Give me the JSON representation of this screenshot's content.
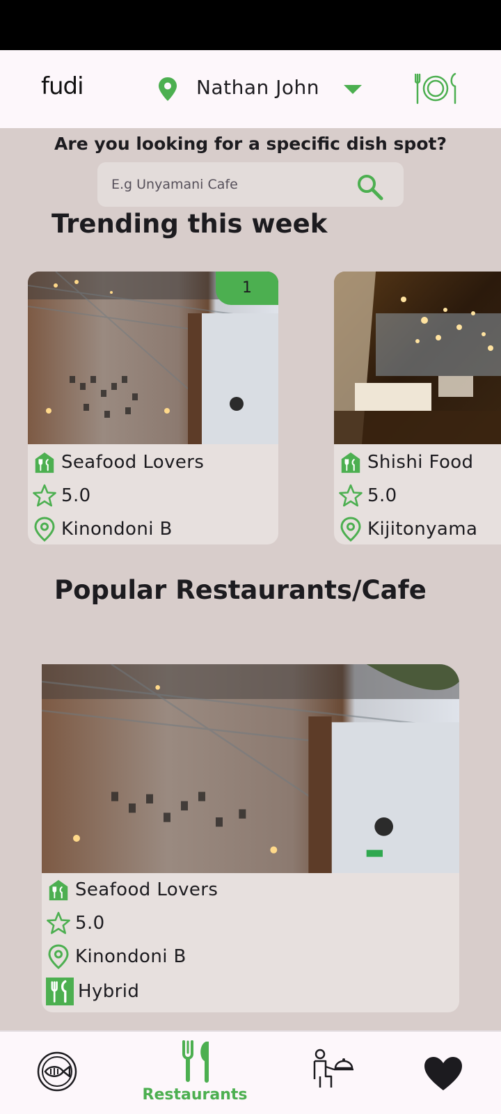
{
  "header": {
    "logo": "fudi",
    "user_name": "Nathan John"
  },
  "search": {
    "question": "Are you looking for a specific dish spot?",
    "placeholder": "E.g Unyamani Cafe"
  },
  "trending": {
    "title": "Trending this week",
    "cards": [
      {
        "rank": "1",
        "name": "Seafood Lovers",
        "rating": "5.0",
        "location": "Kinondoni B"
      },
      {
        "name": "Shishi Food",
        "rating": "5.0",
        "location": "Kijitonyama"
      }
    ]
  },
  "popular": {
    "title": "Popular Restaurants/Cafe",
    "cards": [
      {
        "name": "Seafood Lovers",
        "rating": "5.0",
        "location": "Kinondoni B",
        "type": "Hybrid"
      }
    ]
  },
  "bottom_nav": {
    "active_label": "Restaurants",
    "items": [
      "fish-dish-icon",
      "fork-knife-icon",
      "waiter-icon",
      "heart-icon"
    ]
  },
  "colors": {
    "accent": "#4caf50",
    "background": "#d8cdcb",
    "card": "#e7e0de",
    "appbar": "#fdf7fb"
  }
}
